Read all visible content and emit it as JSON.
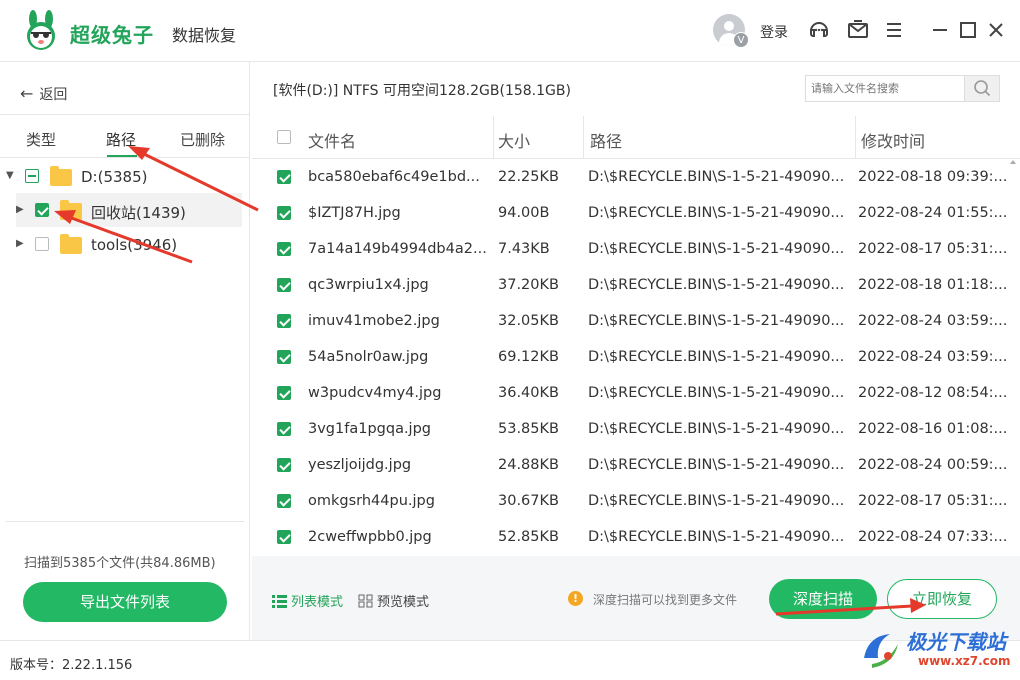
{
  "app": {
    "brand": "超级兔子",
    "product": "数据恢复"
  },
  "header": {
    "avatar_badge": "V",
    "login_label": "登录"
  },
  "left": {
    "back_label": "返回",
    "tabs": [
      {
        "label": "类型"
      },
      {
        "label": "路径"
      },
      {
        "label": "已删除"
      }
    ],
    "tree": [
      {
        "label": "D:(5385)"
      },
      {
        "label": "回收站(1439)"
      },
      {
        "label": "tools(3946)"
      }
    ],
    "scan_info": "扫描到5385个文件(共84.86MB)",
    "export_label": "导出文件列表"
  },
  "main": {
    "path_info": "[软件(D:)] NTFS 可用空间128.2GB(158.1GB)",
    "search_placeholder": "请输入文件名搜索",
    "columns": {
      "name": "文件名",
      "size": "大小",
      "path": "路径",
      "mtime": "修改时间"
    },
    "rows": [
      {
        "name": "bca580ebaf6c49e1bd...",
        "size": "22.25KB",
        "path": "D:\\$RECYCLE.BIN\\S-1-5-21-49090...",
        "mtime": "2022-08-18 09:39:..."
      },
      {
        "name": "$IZTJ87H.jpg",
        "size": "94.00B",
        "path": "D:\\$RECYCLE.BIN\\S-1-5-21-49090...",
        "mtime": "2022-08-24 01:55:..."
      },
      {
        "name": "7a14a149b4994db4a2...",
        "size": "7.43KB",
        "path": "D:\\$RECYCLE.BIN\\S-1-5-21-49090...",
        "mtime": "2022-08-17 05:31:..."
      },
      {
        "name": "qc3wrpiu1x4.jpg",
        "size": "37.20KB",
        "path": "D:\\$RECYCLE.BIN\\S-1-5-21-49090...",
        "mtime": "2022-08-18 01:18:..."
      },
      {
        "name": "imuv41mobe2.jpg",
        "size": "32.05KB",
        "path": "D:\\$RECYCLE.BIN\\S-1-5-21-49090...",
        "mtime": "2022-08-24 03:59:..."
      },
      {
        "name": "54a5nolr0aw.jpg",
        "size": "69.12KB",
        "path": "D:\\$RECYCLE.BIN\\S-1-5-21-49090...",
        "mtime": "2022-08-24 03:59:..."
      },
      {
        "name": "w3pudcv4my4.jpg",
        "size": "36.40KB",
        "path": "D:\\$RECYCLE.BIN\\S-1-5-21-49090...",
        "mtime": "2022-08-12 08:54:..."
      },
      {
        "name": "3vg1fa1pgqa.jpg",
        "size": "53.85KB",
        "path": "D:\\$RECYCLE.BIN\\S-1-5-21-49090...",
        "mtime": "2022-08-16 01:08:..."
      },
      {
        "name": "yeszljoijdg.jpg",
        "size": "24.88KB",
        "path": "D:\\$RECYCLE.BIN\\S-1-5-21-49090...",
        "mtime": "2022-08-24 00:59:..."
      },
      {
        "name": "omkgsrh44pu.jpg",
        "size": "30.67KB",
        "path": "D:\\$RECYCLE.BIN\\S-1-5-21-49090...",
        "mtime": "2022-08-17 05:31:..."
      },
      {
        "name": "2cweffwpbb0.jpg",
        "size": "52.85KB",
        "path": "D:\\$RECYCLE.BIN\\S-1-5-21-49090...",
        "mtime": "2022-08-24 07:33:..."
      }
    ]
  },
  "bottom": {
    "list_mode": "列表模式",
    "preview_mode": "预览模式",
    "hint": "深度扫描可以找到更多文件",
    "deep_scan": "深度扫描",
    "recover": "立即恢复"
  },
  "status": {
    "version": "版本号：2.22.1.156"
  },
  "watermark": {
    "title": "极光下载站",
    "url": "www.xz7.com"
  },
  "colors": {
    "accent": "#22b864",
    "folder": "#f9c646",
    "annotation": "#e53a2b"
  }
}
